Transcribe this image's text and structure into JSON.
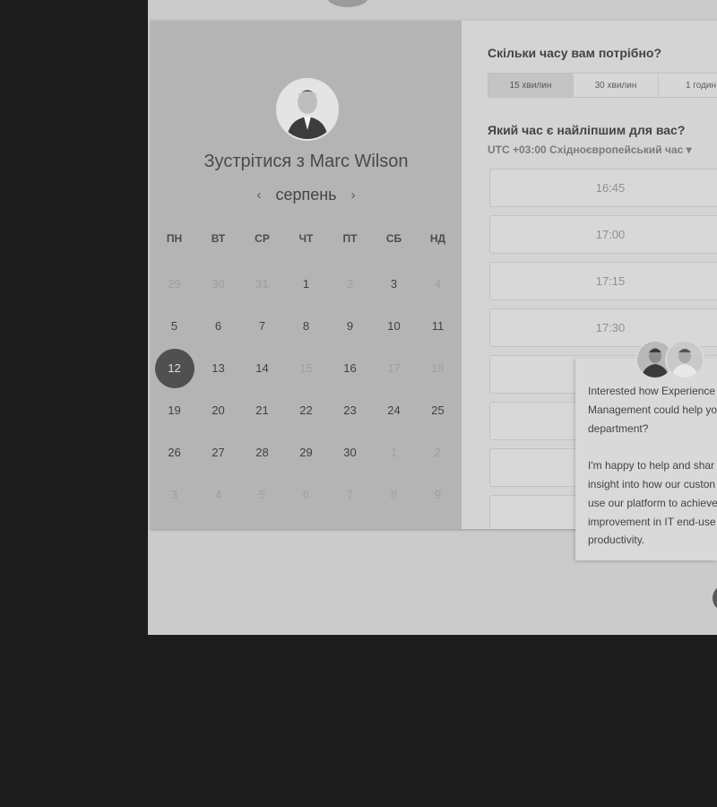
{
  "host": {
    "title": "Зустрітися з Marc Wilson",
    "avatar_icon": "person-avatar-icon"
  },
  "calendar": {
    "month": "серпень",
    "prev_icon": "‹",
    "next_icon": "›",
    "weekdays": [
      "ПН",
      "ВТ",
      "СР",
      "ЧТ",
      "ПТ",
      "СБ",
      "НД"
    ],
    "days": [
      {
        "label": "29",
        "state": "out"
      },
      {
        "label": "30",
        "state": "out"
      },
      {
        "label": "31",
        "state": "out"
      },
      {
        "label": "1",
        "state": "available"
      },
      {
        "label": "2",
        "state": "unavailable"
      },
      {
        "label": "3",
        "state": "available"
      },
      {
        "label": "4",
        "state": "unavailable"
      },
      {
        "label": "5",
        "state": "available"
      },
      {
        "label": "6",
        "state": "available"
      },
      {
        "label": "7",
        "state": "available"
      },
      {
        "label": "8",
        "state": "available"
      },
      {
        "label": "9",
        "state": "available"
      },
      {
        "label": "10",
        "state": "available"
      },
      {
        "label": "11",
        "state": "available"
      },
      {
        "label": "12",
        "state": "selected"
      },
      {
        "label": "13",
        "state": "available"
      },
      {
        "label": "14",
        "state": "available"
      },
      {
        "label": "15",
        "state": "unavailable"
      },
      {
        "label": "16",
        "state": "available"
      },
      {
        "label": "17",
        "state": "unavailable"
      },
      {
        "label": "18",
        "state": "unavailable"
      },
      {
        "label": "19",
        "state": "available"
      },
      {
        "label": "20",
        "state": "available"
      },
      {
        "label": "21",
        "state": "available"
      },
      {
        "label": "22",
        "state": "available"
      },
      {
        "label": "23",
        "state": "available"
      },
      {
        "label": "24",
        "state": "available"
      },
      {
        "label": "25",
        "state": "available"
      },
      {
        "label": "26",
        "state": "available"
      },
      {
        "label": "27",
        "state": "available"
      },
      {
        "label": "28",
        "state": "available"
      },
      {
        "label": "29",
        "state": "available"
      },
      {
        "label": "30",
        "state": "available"
      },
      {
        "label": "1",
        "state": "out"
      },
      {
        "label": "2",
        "state": "out"
      },
      {
        "label": "3",
        "state": "out"
      },
      {
        "label": "4",
        "state": "out"
      },
      {
        "label": "5",
        "state": "out"
      },
      {
        "label": "6",
        "state": "out"
      },
      {
        "label": "7",
        "state": "out"
      },
      {
        "label": "8",
        "state": "out"
      },
      {
        "label": "9",
        "state": "out"
      }
    ]
  },
  "duration": {
    "question": "Скільки часу вам потрібно?",
    "options": [
      "15 хвилин",
      "30 хвилин",
      "1 годин"
    ],
    "selected": "15 хвилин"
  },
  "times": {
    "question": "Який час є найліпшим для вас?",
    "timezone": "UTC +03:00 Східноєвропейський час ▾",
    "slots": [
      "16:45",
      "17:00",
      "17:15",
      "17:30",
      "",
      "",
      "",
      ""
    ]
  },
  "chat_popup": {
    "text": "Interested how Experience\nManagement could help yo\ndepartment?\n\nI'm happy to help and shar\ninsight into how our custon\nuse our platform to achieve\nimprovement in IT end-use\nproductivity."
  },
  "colors": {
    "background": "#1c1c1c",
    "calendar_panel": "#b4b4b4",
    "selected_day": "#505050"
  }
}
